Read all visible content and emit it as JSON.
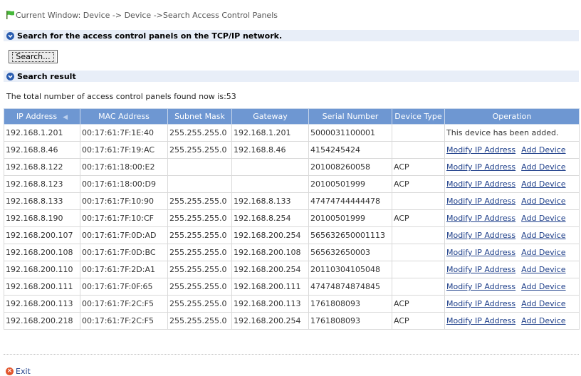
{
  "breadcrumb": "Current Window: Device -> Device ->Search Access Control Panels",
  "search_section": {
    "title": "Search for the access control panels on the TCP/IP network."
  },
  "search_button": "Search...",
  "result_section": {
    "title": "Search result"
  },
  "count_text": "The total number of access control panels found now is:53",
  "table": {
    "columns": [
      "IP Address",
      "MAC Address",
      "Subnet Mask",
      "Gateway",
      "Serial Number",
      "Device Type",
      "Operation"
    ],
    "rows": [
      {
        "ip": "192.168.1.201",
        "mac": "00:17:61:7F:1E:40",
        "mask": "255.255.255.0",
        "gw": "192.168.1.201",
        "sn": "5000031100001",
        "type": "",
        "status": "This device has been added."
      },
      {
        "ip": "192.168.8.46",
        "mac": "00:17:61:7F:19:AC",
        "mask": "255.255.255.0",
        "gw": "192.168.8.46",
        "sn": "4154245424",
        "type": "",
        "status": ""
      },
      {
        "ip": "192.168.8.122",
        "mac": "00:17:61:18:00:E2",
        "mask": "",
        "gw": "",
        "sn": "201008260058",
        "type": "ACP",
        "status": ""
      },
      {
        "ip": "192.168.8.123",
        "mac": "00:17:61:18:00:D9",
        "mask": "",
        "gw": "",
        "sn": "20100501999",
        "type": "ACP",
        "status": ""
      },
      {
        "ip": "192.168.8.133",
        "mac": "00:17:61:7F:10:90",
        "mask": "255.255.255.0",
        "gw": "192.168.8.133",
        "sn": "47474744444478",
        "type": "",
        "status": ""
      },
      {
        "ip": "192.168.8.190",
        "mac": "00:17:61:7F:10:CF",
        "mask": "255.255.255.0",
        "gw": "192.168.8.254",
        "sn": "20100501999",
        "type": "ACP",
        "status": ""
      },
      {
        "ip": "192.168.200.107",
        "mac": "00:17:61:7F:0D:AD",
        "mask": "255.255.255.0",
        "gw": "192.168.200.254",
        "sn": "565632650001113",
        "type": "",
        "status": ""
      },
      {
        "ip": "192.168.200.108",
        "mac": "00:17:61:7F:0D:BC",
        "mask": "255.255.255.0",
        "gw": "192.168.200.108",
        "sn": "565632650003",
        "type": "",
        "status": ""
      },
      {
        "ip": "192.168.200.110",
        "mac": "00:17:61:7F:2D:A1",
        "mask": "255.255.255.0",
        "gw": "192.168.200.254",
        "sn": "20110304105048",
        "type": "",
        "status": ""
      },
      {
        "ip": "192.168.200.111",
        "mac": "00:17:61:7F:0F:65",
        "mask": "255.255.255.0",
        "gw": "192.168.200.111",
        "sn": "47474874874845",
        "type": "",
        "status": ""
      },
      {
        "ip": "192.168.200.113",
        "mac": "00:17:61:7F:2C:F5",
        "mask": "255.255.255.0",
        "gw": "192.168.200.113",
        "sn": "1761808093",
        "type": "ACP",
        "status": ""
      },
      {
        "ip": "192.168.200.218",
        "mac": "00:17:61:7F:2C:F5",
        "mask": "255.255.255.0",
        "gw": "192.168.200.254",
        "sn": "1761808093",
        "type": "ACP",
        "status": ""
      }
    ],
    "action_modify": "Modify IP Address",
    "action_add": "Add Device"
  },
  "exit_label": "Exit",
  "colors": {
    "header_bg": "#6e97d2",
    "section_bg": "#e8eef8",
    "link": "#1e3f8a"
  },
  "icons": {
    "breadcrumb": "flag-icon",
    "section": "chevron-down-circle-icon",
    "exit": "exit-icon"
  }
}
